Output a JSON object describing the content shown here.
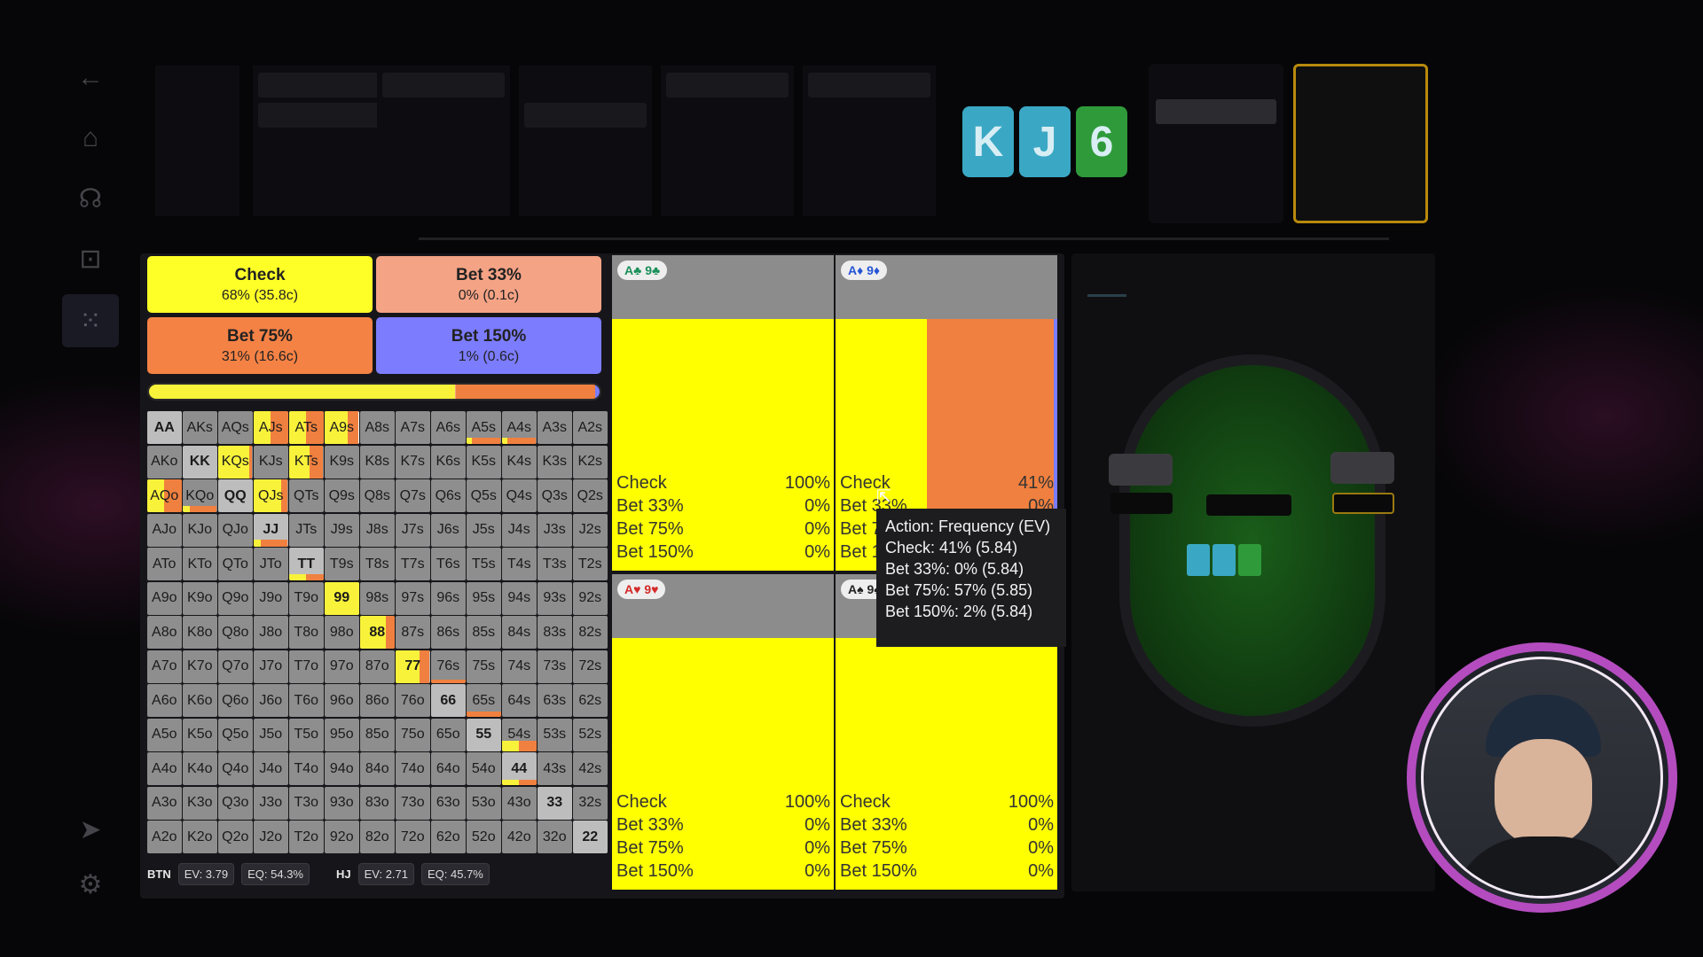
{
  "actions": [
    {
      "label": "Check",
      "sub": "68% (35.8c)",
      "color": "#ffff28"
    },
    {
      "label": "Bet 33%",
      "sub": "0% (0.1c)",
      "color": "#f5a385"
    },
    {
      "label": "Bet 75%",
      "sub": "31% (16.6c)",
      "color": "#f58245"
    },
    {
      "label": "Bet 150%",
      "sub": "1% (0.6c)",
      "color": "#7c7cff"
    }
  ],
  "summary_bar": {
    "check": 0.68,
    "bet33": 0.002,
    "bet75": 0.31,
    "bet150": 0.01
  },
  "range_grid": [
    [
      "AA",
      "AKs",
      "AQs",
      "AJs",
      "ATs",
      "A9s",
      "A8s",
      "A7s",
      "A6s",
      "A5s",
      "A4s",
      "A3s",
      "A2s"
    ],
    [
      "AKo",
      "KK",
      "KQs",
      "KJs",
      "KTs",
      "K9s",
      "K8s",
      "K7s",
      "K6s",
      "K5s",
      "K4s",
      "K3s",
      "K2s"
    ],
    [
      "AQo",
      "KQo",
      "QQ",
      "QJs",
      "QTs",
      "Q9s",
      "Q8s",
      "Q7s",
      "Q6s",
      "Q5s",
      "Q4s",
      "Q3s",
      "Q2s"
    ],
    [
      "AJo",
      "KJo",
      "QJo",
      "JJ",
      "JTs",
      "J9s",
      "J8s",
      "J7s",
      "J6s",
      "J5s",
      "J4s",
      "J3s",
      "J2s"
    ],
    [
      "ATo",
      "KTo",
      "QTo",
      "JTo",
      "TT",
      "T9s",
      "T8s",
      "T7s",
      "T6s",
      "T5s",
      "T4s",
      "T3s",
      "T2s"
    ],
    [
      "A9o",
      "K9o",
      "Q9o",
      "J9o",
      "T9o",
      "99",
      "98s",
      "97s",
      "96s",
      "95s",
      "94s",
      "93s",
      "92s"
    ],
    [
      "A8o",
      "K8o",
      "Q8o",
      "J8o",
      "T8o",
      "98o",
      "88",
      "87s",
      "86s",
      "85s",
      "84s",
      "83s",
      "82s"
    ],
    [
      "A7o",
      "K7o",
      "Q7o",
      "J7o",
      "T7o",
      "97o",
      "87o",
      "77",
      "76s",
      "75s",
      "74s",
      "73s",
      "72s"
    ],
    [
      "A6o",
      "K6o",
      "Q6o",
      "J6o",
      "T6o",
      "96o",
      "86o",
      "76o",
      "66",
      "65s",
      "64s",
      "63s",
      "62s"
    ],
    [
      "A5o",
      "K5o",
      "Q5o",
      "J5o",
      "T5o",
      "95o",
      "85o",
      "75o",
      "65o",
      "55",
      "54s",
      "53s",
      "52s"
    ],
    [
      "A4o",
      "K4o",
      "Q4o",
      "J4o",
      "T4o",
      "94o",
      "84o",
      "74o",
      "64o",
      "54o",
      "44",
      "43s",
      "42s"
    ],
    [
      "A3o",
      "K3o",
      "Q3o",
      "J3o",
      "T3o",
      "93o",
      "83o",
      "73o",
      "63o",
      "53o",
      "43o",
      "33",
      "32s"
    ],
    [
      "A2o",
      "K2o",
      "Q2o",
      "J2o",
      "T2o",
      "92o",
      "82o",
      "72o",
      "62o",
      "52o",
      "42o",
      "32o",
      "22"
    ]
  ],
  "hand_freqs": {
    "AJs": {
      "check": 0.5,
      "bet": 0.5
    },
    "ATs": {
      "check": 0.5,
      "bet": 0.5
    },
    "A9s": {
      "check": 0.68,
      "bet": 0.32
    },
    "A5s": {
      "check": 0.15,
      "bet": 0.85,
      "partial": 0.2
    },
    "A4s": {
      "check": 0.15,
      "bet": 0.85,
      "partial": 0.2
    },
    "KQs": {
      "check": 0.9,
      "bet": 0.1
    },
    "KTs": {
      "check": 0.6,
      "bet": 0.4
    },
    "AQo": {
      "check": 0.5,
      "bet": 0.5
    },
    "KQo": {
      "check": 0.2,
      "bet": 0.8,
      "partial": 0.2
    },
    "QJs": {
      "check": 0.8,
      "bet": 0.2
    },
    "JJ": {
      "check": 0.2,
      "bet": 0.8,
      "partial": 0.2
    },
    "TT": {
      "check": 0.5,
      "bet": 0.5,
      "partial": 0.2
    },
    "99": {
      "check": 1.0,
      "bet": 0.0
    },
    "88": {
      "check": 0.75,
      "bet": 0.25
    },
    "77": {
      "check": 0.7,
      "bet": 0.3
    },
    "76s": {
      "check": 0.0,
      "bet": 1.0,
      "partial": 0.1
    },
    "65s": {
      "check": 0.0,
      "bet": 1.0,
      "partial": 0.15
    },
    "54s": {
      "check": 0.5,
      "bet": 0.5,
      "partial": 0.3
    },
    "44": {
      "check": 0.5,
      "bet": 0.5,
      "partial": 0.15
    }
  },
  "selected_hand": "A9s",
  "footer": {
    "p1": {
      "pos": "BTN",
      "ev": "EV: 3.79",
      "eq": "EQ: 54.3%"
    },
    "p2": {
      "pos": "HJ",
      "ev": "EV: 2.71",
      "eq": "EQ: 45.7%"
    }
  },
  "combos": [
    {
      "tag": "A♣ 9♣",
      "tag_color": "#1a8f5a",
      "check": "100%",
      "b33": "0%",
      "b75": "0%",
      "b150": "0%",
      "check_frac": 1.0
    },
    {
      "tag": "A♦ 9♦",
      "tag_color": "#2455d6",
      "check": "41%",
      "b33": "0%",
      "b75": "57%",
      "b150": "2%",
      "check_frac": 0.41
    },
    {
      "tag": "A♥ 9♥",
      "tag_color": "#d42a2a",
      "check": "100%",
      "b33": "0%",
      "b75": "0%",
      "b150": "0%",
      "check_frac": 1.0
    },
    {
      "tag": "A♠ 9♠",
      "tag_color": "#222222",
      "check": "100%",
      "b33": "0%",
      "b75": "0%",
      "b150": "0%",
      "check_frac": 1.0
    }
  ],
  "combo_labels": {
    "check": "Check",
    "b33": "Bet 33%",
    "b75": "Bet 75%",
    "b150": "Bet 150%"
  },
  "tooltip": {
    "title": "Action: Frequency (EV)",
    "lines": [
      "Check: 41% (5.84)",
      "Bet 33%: 0% (5.84)",
      "Bet 75%: 57% (5.85)",
      "Bet 150%: 2% (5.84)"
    ]
  },
  "board": [
    {
      "rank": "K",
      "color": "#3aa8c4"
    },
    {
      "rank": "J",
      "color": "#3aa8c4"
    },
    {
      "rank": "6",
      "color": "#2f9a3a"
    }
  ],
  "icons": [
    "back-arrow-icon",
    "home-icon",
    "brain-icon",
    "gamepad-icon",
    "grid-icon",
    "send-icon",
    "gear-icon"
  ]
}
